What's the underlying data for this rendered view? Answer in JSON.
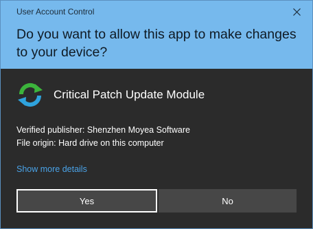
{
  "dialog": {
    "title": "User Account Control",
    "question": "Do you want to allow this app to make changes to your device?",
    "app_name": "Critical Patch Update Module",
    "publisher_line": "Verified publisher: Shenzhen Moyea Software",
    "origin_line": "File origin: Hard drive on this computer",
    "show_more_label": "Show more details",
    "yes_label": "Yes",
    "no_label": "No",
    "close_icon": "close-icon",
    "app_icon": "refresh-arrows-icon"
  },
  "colors": {
    "header_bg": "#76b9ed",
    "body_bg": "#2b2b2b",
    "link": "#4aa3e8",
    "button_bg": "#474747"
  }
}
